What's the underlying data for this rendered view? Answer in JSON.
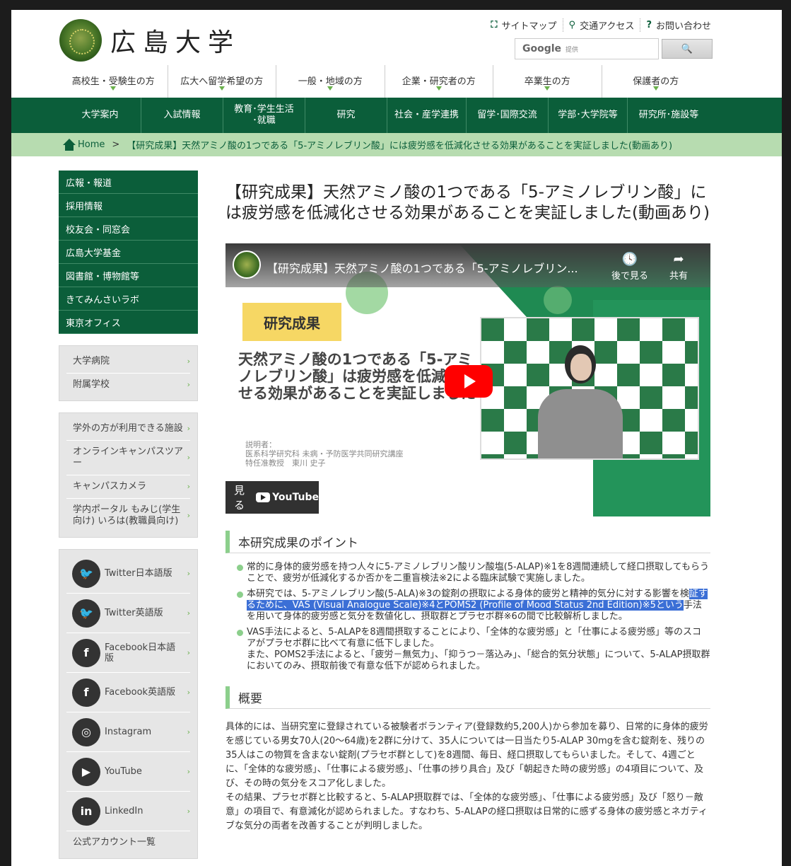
{
  "header": {
    "logo_text": "広島大学",
    "utility": [
      {
        "icon": "sitemap-icon",
        "glyph": "⛶",
        "label": "サイトマップ"
      },
      {
        "icon": "map-pin-icon",
        "glyph": "⚲",
        "label": "交通アクセス"
      },
      {
        "icon": "question-icon",
        "glyph": "?",
        "label": "お問い合わせ"
      }
    ],
    "search": {
      "brand": "Google",
      "provided": "提供",
      "button": "🔍"
    },
    "audience": [
      "高校生・受験生の方",
      "広大へ留学希望の方",
      "一般・地域の方",
      "企業・研究者の方",
      "卒業生の方",
      "保護者の方"
    ],
    "main_nav": [
      "大学案内",
      "入試情報",
      "教育･学生生活\n･就職",
      "研究",
      "社会・産学連携",
      "留学･国際交流",
      "学部･大学院等",
      "研究所･施設等"
    ]
  },
  "breadcrumb": {
    "home": "Home",
    "separator": ">",
    "current": "【研究成果】天然アミノ酸の1つである「5-アミノレブリン酸」には疲労感を低減化させる効果があることを実証しました(動画あり)"
  },
  "sidebar": {
    "green_links": [
      "広報・報道",
      "採用情報",
      "校友会・同窓会",
      "広島大学基金",
      "図書館・博物館等",
      "きてみんさいラボ",
      "東京オフィス"
    ],
    "box1": [
      "大学病院",
      "附属学校"
    ],
    "box2": [
      "学外の方が利用できる施設",
      "オンラインキャンパスツアー",
      "キャンパスカメラ",
      "学内ポータル もみじ(学生向け) いろは(教職員向け)"
    ],
    "social": [
      {
        "icon": "twitter-icon",
        "glyph": "🐦",
        "label": "Twitter日本語版"
      },
      {
        "icon": "twitter-icon",
        "glyph": "🐦",
        "label": "Twitter英語版"
      },
      {
        "icon": "facebook-icon",
        "glyph": "f",
        "label": "Facebook日本語版"
      },
      {
        "icon": "facebook-icon",
        "glyph": "f",
        "label": "Facebook英語版"
      },
      {
        "icon": "instagram-icon",
        "glyph": "◎",
        "label": "Instagram"
      },
      {
        "icon": "youtube-icon",
        "glyph": "▶",
        "label": "YouTube"
      },
      {
        "icon": "linkedin-icon",
        "glyph": "in",
        "label": "LinkedIn"
      }
    ],
    "more": "公式アカウント一覧"
  },
  "article": {
    "title": "【研究成果】天然アミノ酸の1つである「5-アミノレブリン酸」には疲労感を低減化させる効果があることを実証しました(動画あり)",
    "video": {
      "title": "【研究成果】天然アミノ酸の1つである「5-アミノレブリン...",
      "watch_later": "後で見る",
      "share": "共有",
      "badge": "研究成果",
      "headline": "天然アミノ酸の1つである「5-アミノレブリン酸」は疲労感を低減化させる効果があることを実証しました",
      "presenter": "説明者：\n医系科学研究科 未病・予防医学共同研究講座\n特任准教授　東川 史子",
      "watch_on": "見る",
      "youtube": "YouTube"
    },
    "points_heading": "本研究成果のポイント",
    "points": [
      {
        "text": "常的に身体的疲労感を持つ人々に5-アミノレブリン酸リン酸塩(5-ALAP)※1を8週間連続して経口摂取してもらうことで、疲労が低減化するか否かを二重盲検法※2による臨床試験で実施しました。"
      },
      {
        "pre": "本研究では、5-アミノレブリン酸(5-ALA)※3の錠剤の摂取による身体的疲労と精神的気分に対する影響を検",
        "highlight": "証するために、VAS (Visual Analogue Scale)※4とPOMS2 (Profile of Mood Status 2nd Edition)※5という",
        "post": "手法を用いて身体的疲労感と気分を数値化し、摂取群とプラセボ群※6の間で比較解析しました。"
      },
      {
        "text": "VAS手法によると、5-ALAPを8週間摂取することにより、「全体的な疲労感」と「仕事による疲労感」等のスコアがプラセボ群に比べて有意に低下しました。\nまた、POMS2手法によると、「疲労－無気力」、「抑うつ－落込み」、「総合的気分状態」について、5-ALAP摂取群においてのみ、摂取前後で有意な低下が認められました。"
      }
    ],
    "overview_heading": "概要",
    "overview": "具体的には、当研究室に登録されている被験者ボランティア(登録数約5,200人)から参加を募り、日常的に身体的疲労を感じている男女70人(20～64歳)を2群に分けて、35人については一日当たり5-ALAP 30mgを含む錠剤を、残りの35人はこの物質を含まない錠剤(プラセボ群として)を8週間、毎日、経口摂取してもらいました。そして、4週ごとに、「全体的な疲労感」、「仕事による疲労感」、「仕事の捗り具合」及び「朝起きた時の疲労感」の4項目について、及び、その時の気分をスコア化しました。\nその結果、プラセボ群と比較すると、5-ALAP摂取群では、「全体的な疲労感」、「仕事による疲労感」及び「怒り－敵意」の項目で、有意減化が認められました。すなわち、5-ALAPの経口摂取は日常的に感ずる身体の疲労感とネガティブな気分の両者を改善することが判明しました。"
  },
  "colors": {
    "brand_green": "#0b5e3a",
    "light_green": "#b7dcb0",
    "accent": "#8ccf8c"
  }
}
